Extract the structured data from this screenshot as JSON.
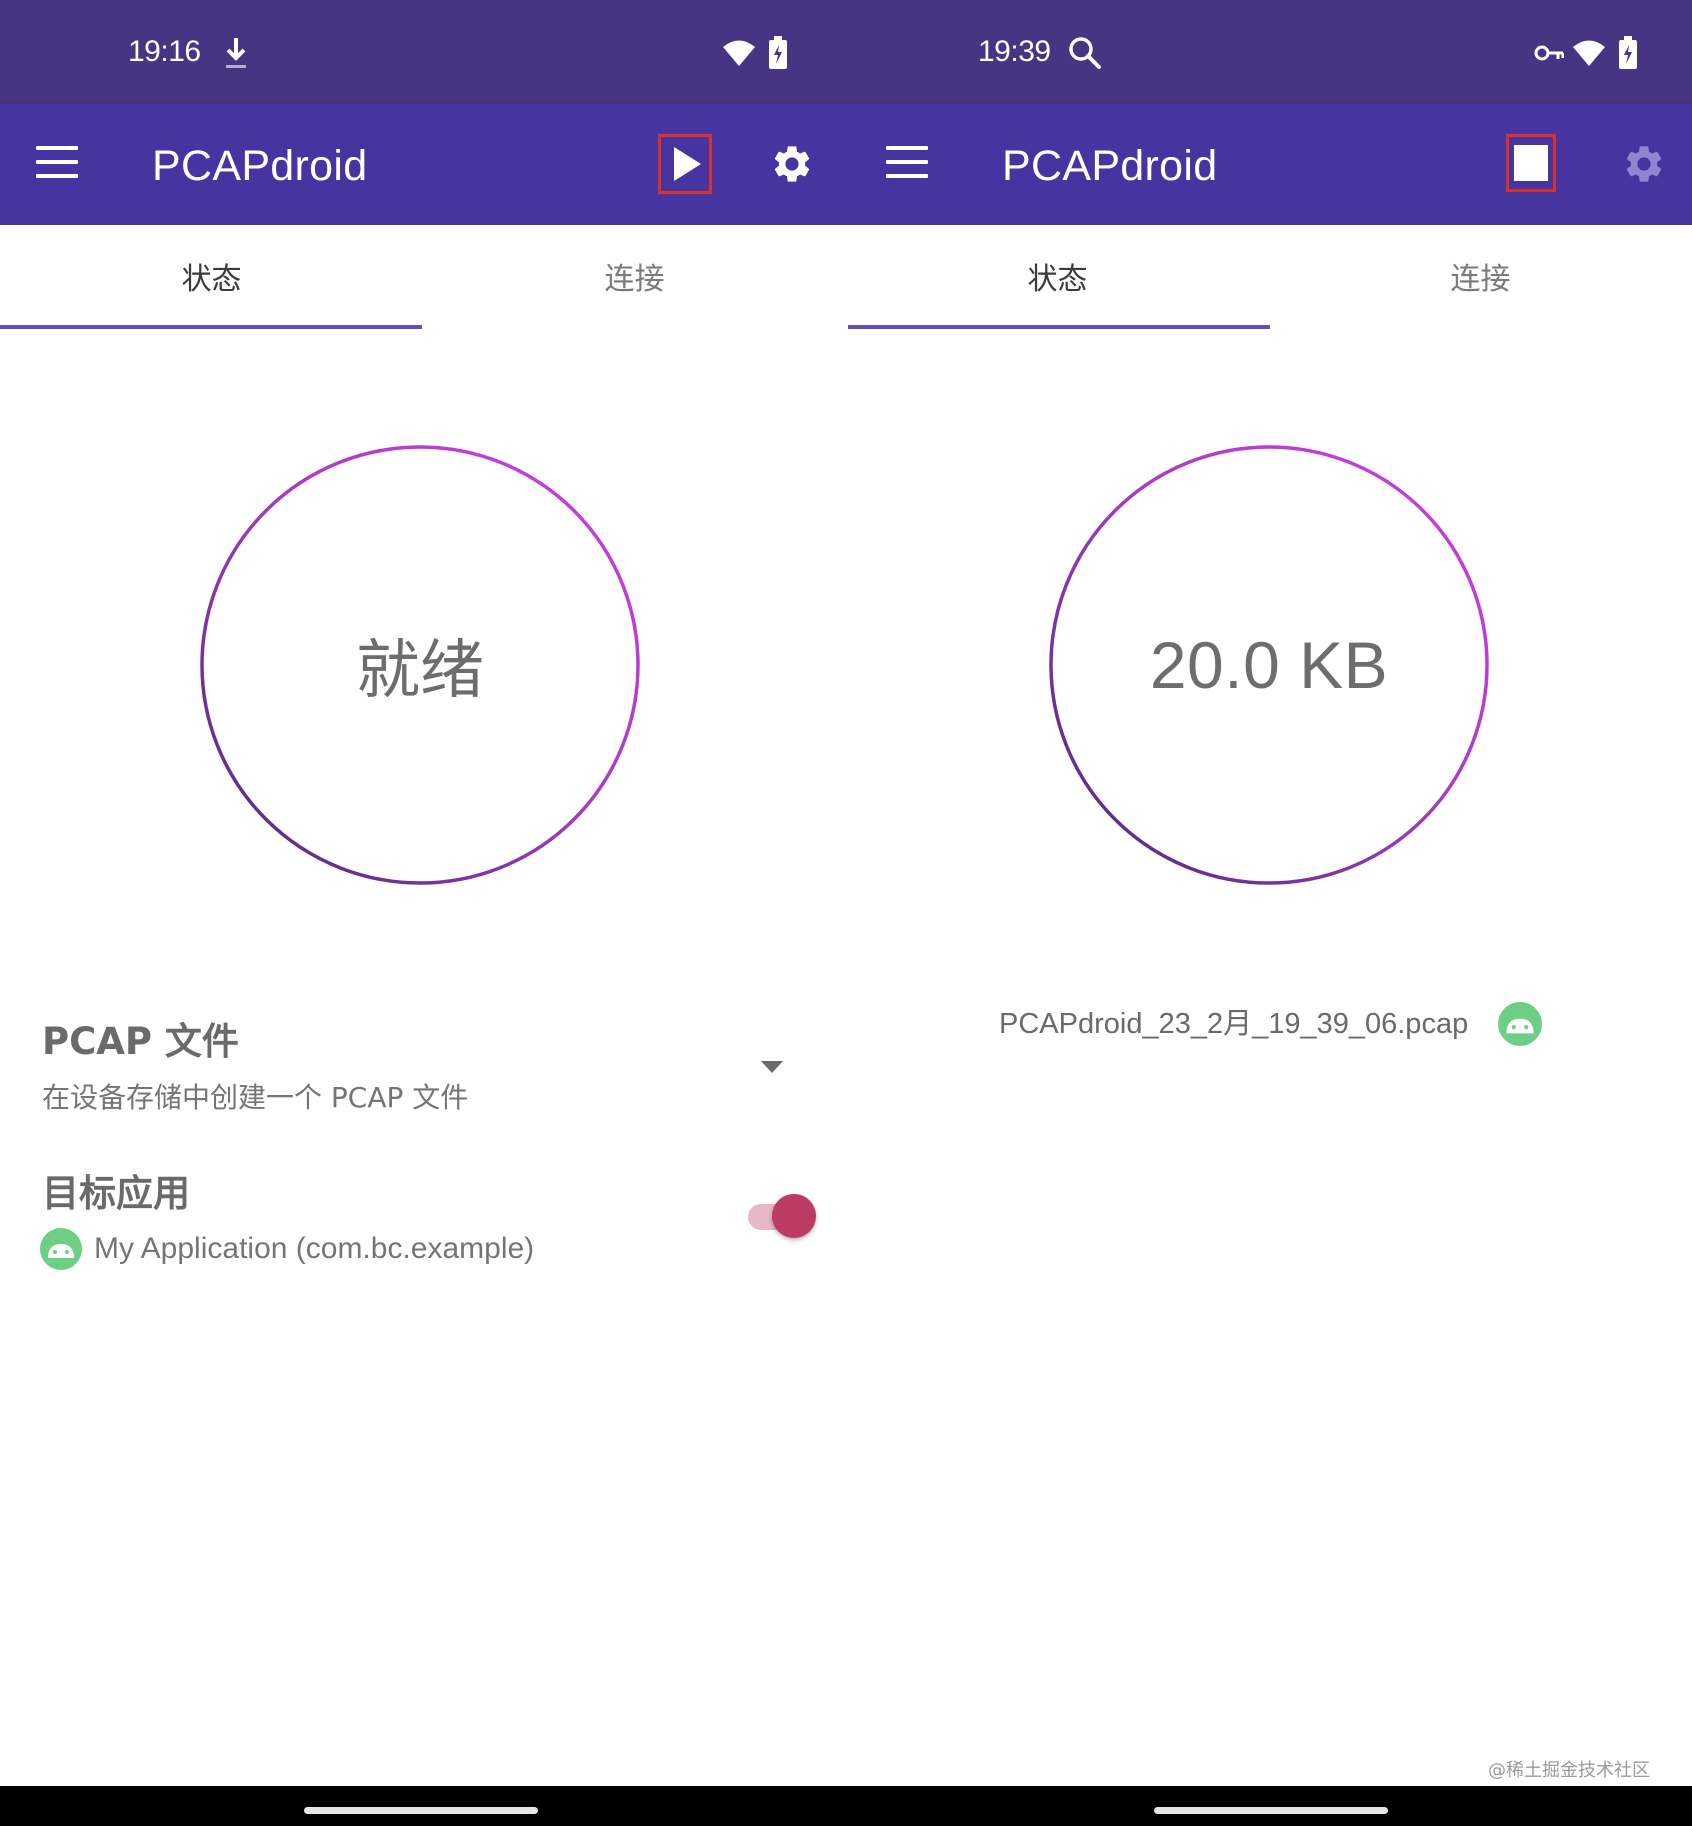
{
  "app": {
    "title": "PCAPdroid"
  },
  "left": {
    "status_bar": {
      "time": "19:16",
      "icons": [
        "download-icon",
        "wifi-icon",
        "battery-icon"
      ]
    },
    "toolbar": {
      "menu_icon": "menu-icon",
      "action_primary_icon": "play-icon",
      "action_secondary_icon": "gear-icon"
    },
    "tabs": [
      {
        "label": "状态",
        "selected": true
      },
      {
        "label": "连接",
        "selected": false
      }
    ],
    "status_ring": {
      "text": "就绪"
    },
    "prefs": {
      "pcap_title": "PCAP 文件",
      "pcap_subtitle": "在设备存储中创建一个 PCAP 文件",
      "target_title": "目标应用",
      "target_app": "My Application (com.bc.example)",
      "target_enabled": true
    }
  },
  "right": {
    "status_bar": {
      "time": "19:39",
      "icons": [
        "search-icon",
        "key-icon",
        "wifi-icon",
        "battery-icon"
      ]
    },
    "toolbar": {
      "menu_icon": "menu-icon",
      "action_primary_icon": "stop-icon",
      "action_secondary_icon": "gear-icon"
    },
    "tabs": [
      {
        "label": "状态",
        "selected": true
      },
      {
        "label": "连接",
        "selected": false
      }
    ],
    "status_ring": {
      "text": "20.0 KB"
    },
    "capture_file": "PCAPdroid_23_2月_19_39_06.pcap"
  },
  "watermark": "@稀土掘金技术社区",
  "colors": {
    "status_bar": "#473482",
    "app_bar": "#4634a0",
    "tab_indicator": "#5f4fb8",
    "ring_start": "#4a2a7a",
    "ring_end": "#d13ee6",
    "toggle_thumb": "#bb3b62",
    "highlight": "#d8312c",
    "android_icon": "#6ccf83"
  }
}
